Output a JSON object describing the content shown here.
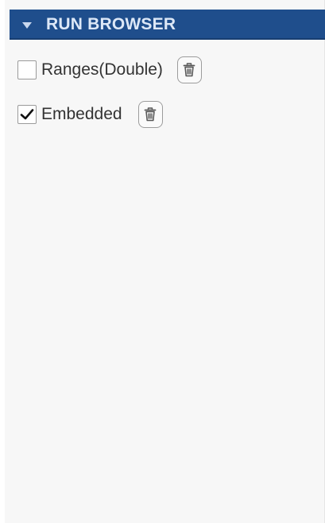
{
  "run_browser": {
    "title": "RUN BROWSER",
    "runs": [
      {
        "label": "Ranges(Double)",
        "checked": false,
        "icon": "trash-icon"
      },
      {
        "label": "Embedded",
        "checked": true,
        "icon": "trash-icon"
      }
    ]
  },
  "colors": {
    "header_bg": "#1f4e8c",
    "header_text": "#dde8f7",
    "panel_bg": "#f7f7f7"
  }
}
